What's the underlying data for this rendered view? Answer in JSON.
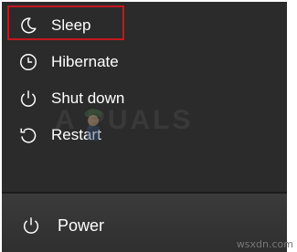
{
  "menu": {
    "items": [
      {
        "label": "Sleep",
        "icon": "moon-icon"
      },
      {
        "label": "Hibernate",
        "icon": "clock-icon"
      },
      {
        "label": "Shut down",
        "icon": "power-icon"
      },
      {
        "label": "Restart",
        "icon": "restart-icon"
      }
    ]
  },
  "power_button": {
    "label": "Power",
    "icon": "power-icon"
  },
  "watermark": {
    "text": "A PUALS"
  },
  "site_credit": {
    "text": "wsxdn.com"
  },
  "colors": {
    "menu_bg": "#2b2b2b",
    "text": "#ffffff",
    "highlight": "#c4171d",
    "power_bar_bg": "#353535"
  }
}
